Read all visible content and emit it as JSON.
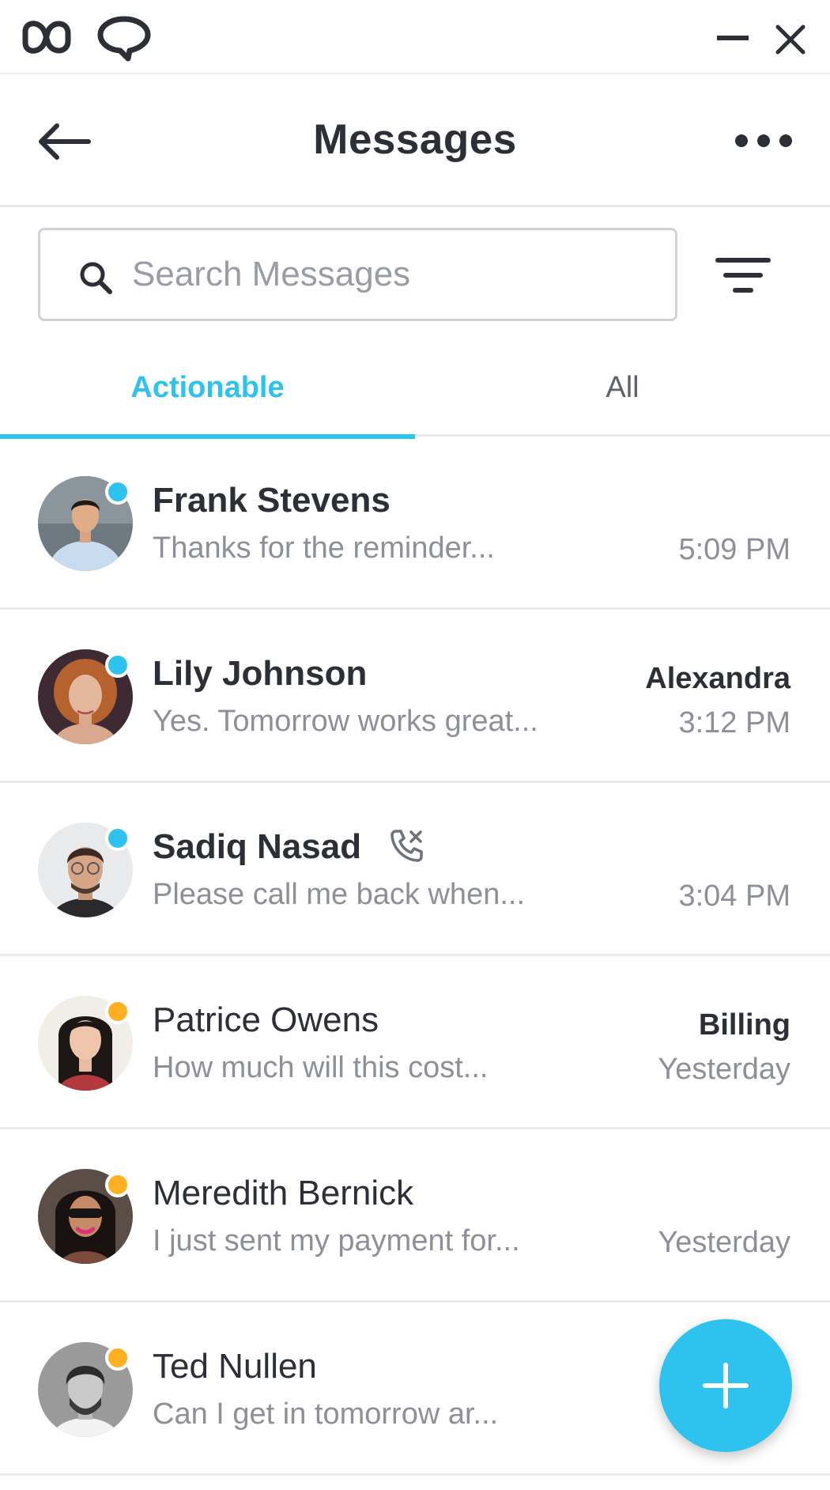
{
  "header": {
    "title": "Messages"
  },
  "search": {
    "placeholder": "Search Messages",
    "value": ""
  },
  "tabs": [
    {
      "label": "Actionable",
      "active": true
    },
    {
      "label": "All",
      "active": false
    }
  ],
  "icons": {
    "titlebar": [
      "app-logo-icon",
      "chat-bubble-icon",
      "minimize-icon",
      "close-icon"
    ],
    "header": [
      "back-arrow-icon",
      "more-options-icon"
    ],
    "search": "search-icon",
    "filter": "filter-icon",
    "missed_call": "missed-call-icon",
    "fab": "plus-icon"
  },
  "colors": {
    "accent": "#2ec3ee",
    "online": "#2ec3ee",
    "away": "#ffb020",
    "text_primary": "#2d2f36",
    "text_secondary": "#8d9096"
  },
  "conversations": [
    {
      "name": "Frank Stevens",
      "preview": "Thanks for the reminder...",
      "assignee": "",
      "time": "5:09 PM",
      "status": "online",
      "unread": true,
      "missed_call": false
    },
    {
      "name": "Lily Johnson",
      "preview": "Yes. Tomorrow works great...",
      "assignee": "Alexandra",
      "time": "3:12 PM",
      "status": "online",
      "unread": true,
      "missed_call": false
    },
    {
      "name": "Sadiq Nasad",
      "preview": "Please call me back when...",
      "assignee": "",
      "time": "3:04 PM",
      "status": "online",
      "unread": true,
      "missed_call": true
    },
    {
      "name": "Patrice Owens",
      "preview": "How much will this cost...",
      "assignee": "Billing",
      "time": "Yesterday",
      "status": "away",
      "unread": false,
      "missed_call": false
    },
    {
      "name": "Meredith Bernick",
      "preview": "I just sent my payment for...",
      "assignee": "",
      "time": "Yesterday",
      "status": "away",
      "unread": false,
      "missed_call": false
    },
    {
      "name": "Ted Nullen",
      "preview": "Can I get in tomorrow ar...",
      "assignee": "",
      "time": "",
      "status": "away",
      "unread": false,
      "missed_call": false
    }
  ]
}
